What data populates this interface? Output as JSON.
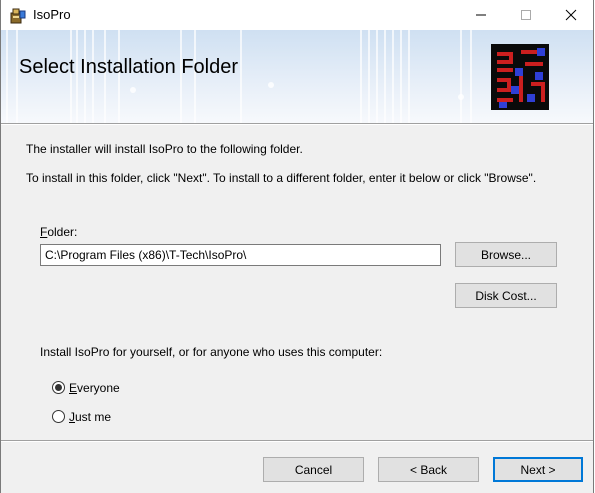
{
  "window": {
    "title": "IsoPro"
  },
  "titlebar_buttons": {
    "minimize": "—",
    "maximize": "☐",
    "close": "✕"
  },
  "banner": {
    "heading": "Select Installation Folder"
  },
  "intro": {
    "line1": "The installer will install IsoPro to the following folder.",
    "line2": "To install in this folder, click \"Next\". To install to a different folder, enter it below or click \"Browse\"."
  },
  "folder": {
    "label_mnemonic": "F",
    "label_rest": "older:",
    "value": "C:\\Program Files (x86)\\T-Tech\\IsoPro\\"
  },
  "buttons": {
    "browse": "Browse...",
    "disk_cost": "Disk Cost...",
    "cancel": "Cancel",
    "back": "< Back",
    "next": "Next >"
  },
  "scope": {
    "prompt": "Install IsoPro for yourself, or for anyone who uses this computer:",
    "options": [
      {
        "mnemonic": "E",
        "rest": "veryone",
        "selected": true
      },
      {
        "mnemonic": "J",
        "rest": "ust me",
        "selected": false
      }
    ]
  },
  "colors": {
    "accent": "#0078d7",
    "chip_red": "#cc1f1f",
    "chip_blue": "#2f3fd6"
  }
}
